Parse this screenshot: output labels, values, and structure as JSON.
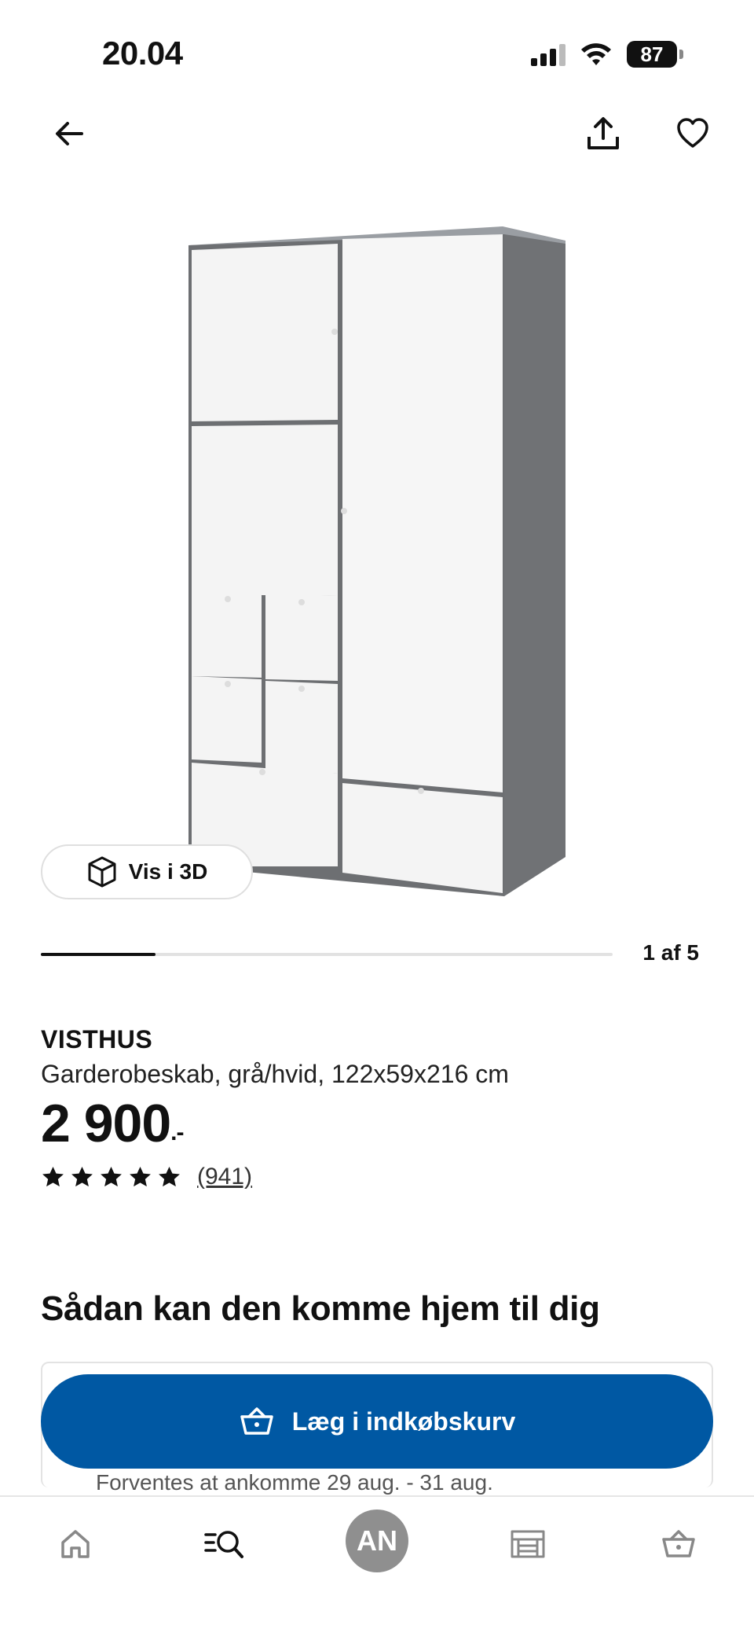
{
  "status_bar": {
    "time": "20.04",
    "battery": "87"
  },
  "nav": {
    "back_icon": "arrow-left-icon",
    "share_icon": "share-icon",
    "favorite_icon": "heart-icon"
  },
  "gallery": {
    "view_3d_label": "Vis i 3D",
    "counter": "1 af 5",
    "progress": 0.2
  },
  "product": {
    "name": "VISTHUS",
    "description": "Garderobeskab, grå/hvid, 122x59x216 cm",
    "price": "2 900",
    "price_suffix": ".-",
    "rating": 5,
    "review_count": "(941)"
  },
  "delivery": {
    "heading": "Sådan kan den komme hjem til dig",
    "add_to_cart_label": "Læg i indkøbskurv",
    "eta": "Forventes at ankomme 29 aug. - 31 aug."
  },
  "tab_bar": {
    "profile_initials": "AN",
    "icons": [
      "home-icon",
      "search-icon",
      "profile-avatar",
      "store-icon",
      "cart-icon"
    ]
  },
  "colors": {
    "primary_blue": "#0058a3",
    "text": "#111111",
    "avatar_gray": "#8f8f8f"
  }
}
